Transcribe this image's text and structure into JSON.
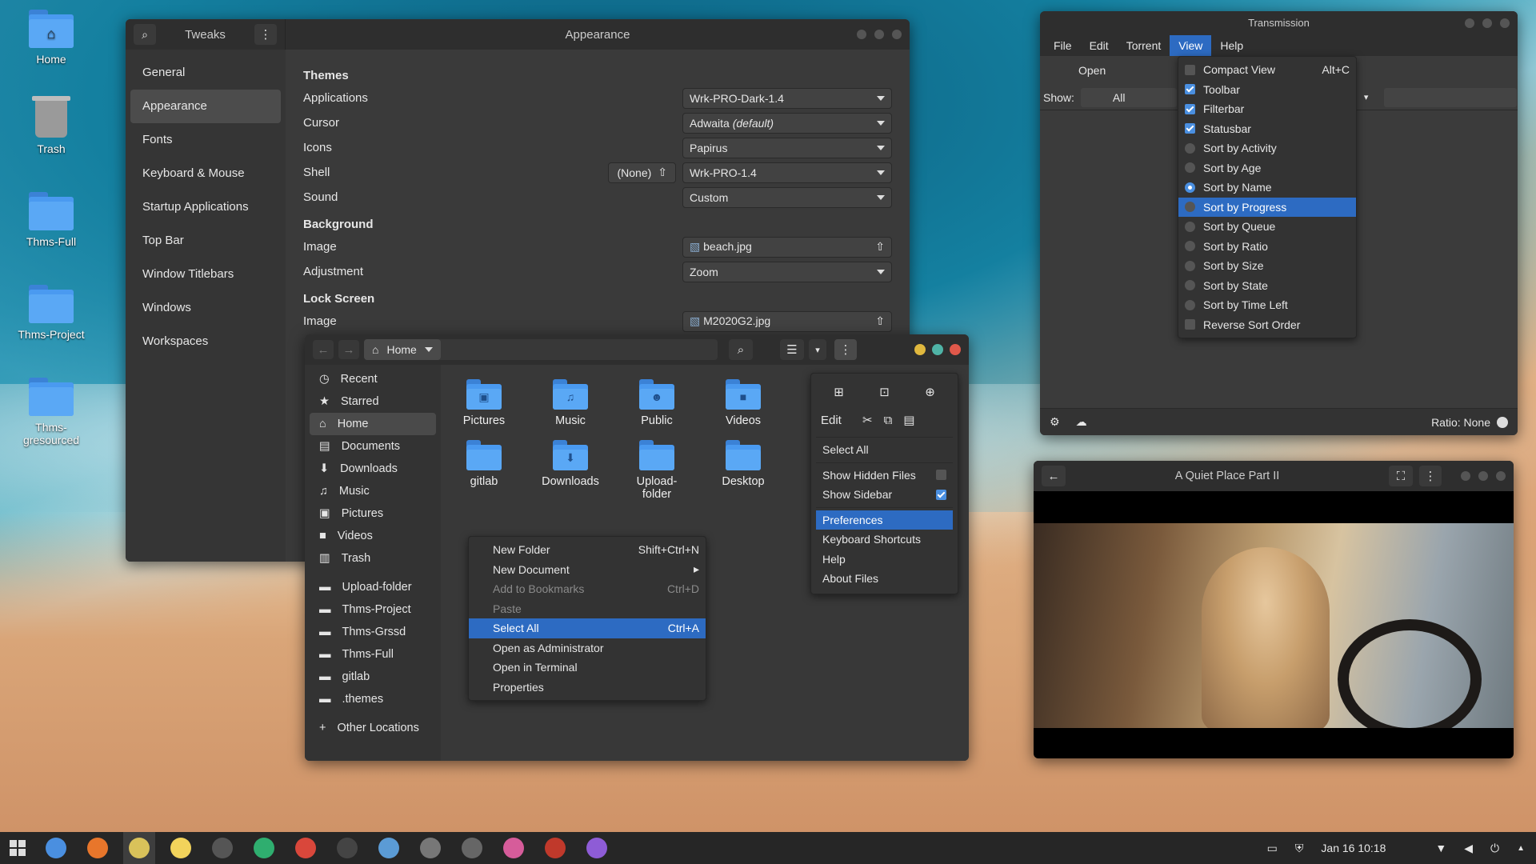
{
  "desktop": {
    "icons": [
      {
        "label": "Home",
        "icon": "home-folder-icon"
      },
      {
        "label": "Trash",
        "icon": "trash-icon"
      },
      {
        "label": "Thms-Full",
        "icon": "folder-icon"
      },
      {
        "label": "Thms-Project",
        "icon": "folder-icon"
      },
      {
        "label": "Thms-gresourced",
        "icon": "folder-icon"
      }
    ]
  },
  "tweaks": {
    "header_label": "Tweaks",
    "title": "Appearance",
    "sidebar": [
      "General",
      "Appearance",
      "Fonts",
      "Keyboard & Mouse",
      "Startup Applications",
      "Top Bar",
      "Window Titlebars",
      "Windows",
      "Workspaces"
    ],
    "themes": {
      "heading": "Themes",
      "applications_label": "Applications",
      "applications_value": "Wrk-PRO-Dark-1.4",
      "cursor_label": "Cursor",
      "cursor_value": "Adwaita",
      "cursor_default": "(default)",
      "icons_label": "Icons",
      "icons_value": "Papirus",
      "shell_label": "Shell",
      "shell_none": "(None)",
      "shell_value": "Wrk-PRO-1.4",
      "sound_label": "Sound",
      "sound_value": "Custom"
    },
    "background": {
      "heading": "Background",
      "image_label": "Image",
      "image_value": "beach.jpg",
      "adjustment_label": "Adjustment",
      "adjustment_value": "Zoom"
    },
    "lockscreen": {
      "heading": "Lock Screen",
      "image_label": "Image",
      "image_value": "M2020G2.jpg"
    }
  },
  "files": {
    "path": "Home",
    "sidebar": [
      "Recent",
      "Starred",
      "Home",
      "Documents",
      "Downloads",
      "Music",
      "Pictures",
      "Videos",
      "Trash"
    ],
    "bookmarks": [
      "Upload-folder",
      "Thms-Project",
      "Thms-Grssd",
      "Thms-Full",
      "gitlab",
      ".themes"
    ],
    "other_locations": "Other Locations",
    "grid": [
      {
        "label": "Pictures",
        "glyph": "▣"
      },
      {
        "label": "Music",
        "glyph": "♫"
      },
      {
        "label": "Public",
        "glyph": "☻"
      },
      {
        "label": "Videos",
        "glyph": "■"
      },
      {
        "label": "gitlab",
        "glyph": ""
      },
      {
        "label": "Downloads",
        "glyph": "⬇"
      },
      {
        "label": "Upload-\nfolder",
        "glyph": ""
      },
      {
        "label": "Desktop",
        "glyph": ""
      }
    ],
    "context_menu": [
      {
        "label": "New Folder",
        "shortcut": "Shift+Ctrl+N",
        "state": ""
      },
      {
        "label": "New Document",
        "shortcut": "▸",
        "state": ""
      },
      {
        "label": "Add to Bookmarks",
        "shortcut": "Ctrl+D",
        "state": "dis"
      },
      {
        "label": "Paste",
        "shortcut": "",
        "state": "dis"
      },
      {
        "label": "Select All",
        "shortcut": "Ctrl+A",
        "state": "hl"
      },
      {
        "label": "Open as Administrator",
        "shortcut": "",
        "state": ""
      },
      {
        "label": "Open in Terminal",
        "shortcut": "",
        "state": ""
      },
      {
        "label": "Properties",
        "shortcut": "",
        "state": ""
      }
    ],
    "app_menu": {
      "edit": "Edit",
      "select_all": "Select All",
      "show_hidden": "Show Hidden Files",
      "show_sidebar": "Show Sidebar",
      "preferences": "Preferences",
      "shortcuts": "Keyboard Shortcuts",
      "help": "Help",
      "about": "About Files"
    }
  },
  "transmission": {
    "title": "Transmission",
    "menubar": [
      "File",
      "Edit",
      "Torrent",
      "View",
      "Help"
    ],
    "open_label": "Open",
    "show_label": "Show:",
    "show_value": "All",
    "ratio": "Ratio: None",
    "view_menu": [
      {
        "label": "Compact View",
        "shortcut": "Alt+C",
        "mark": "chk",
        "on": false,
        "hl": false
      },
      {
        "label": "Toolbar",
        "shortcut": "",
        "mark": "chk",
        "on": true,
        "hl": false
      },
      {
        "label": "Filterbar",
        "shortcut": "",
        "mark": "chk",
        "on": true,
        "hl": false
      },
      {
        "label": "Statusbar",
        "shortcut": "",
        "mark": "chk",
        "on": true,
        "hl": false
      },
      {
        "label": "Sort by Activity",
        "shortcut": "",
        "mark": "rad",
        "on": false,
        "hl": false
      },
      {
        "label": "Sort by Age",
        "shortcut": "",
        "mark": "rad",
        "on": false,
        "hl": false
      },
      {
        "label": "Sort by Name",
        "shortcut": "",
        "mark": "rad",
        "on": true,
        "hl": false
      },
      {
        "label": "Sort by Progress",
        "shortcut": "",
        "mark": "rad",
        "on": false,
        "hl": true
      },
      {
        "label": "Sort by Queue",
        "shortcut": "",
        "mark": "rad",
        "on": false,
        "hl": false
      },
      {
        "label": "Sort by Ratio",
        "shortcut": "",
        "mark": "rad",
        "on": false,
        "hl": false
      },
      {
        "label": "Sort by Size",
        "shortcut": "",
        "mark": "rad",
        "on": false,
        "hl": false
      },
      {
        "label": "Sort by State",
        "shortcut": "",
        "mark": "rad",
        "on": false,
        "hl": false
      },
      {
        "label": "Sort by Time Left",
        "shortcut": "",
        "mark": "rad",
        "on": false,
        "hl": false
      },
      {
        "label": "Reverse Sort Order",
        "shortcut": "",
        "mark": "chk",
        "on": false,
        "hl": false
      }
    ]
  },
  "video": {
    "title": "A Quiet Place Part II"
  },
  "taskbar": {
    "clock": "Jan 16  10:18",
    "apps": [
      {
        "name": "chromium-icon",
        "color": "#4a8fe0"
      },
      {
        "name": "firefox-icon",
        "color": "#e8762b"
      },
      {
        "name": "files-icon",
        "color": "#d9c25a"
      },
      {
        "name": "text-editor-icon",
        "color": "#f2d35b"
      },
      {
        "name": "terminal-icon",
        "color": "#555555"
      },
      {
        "name": "transmission-icon",
        "color": "#2fae6f"
      },
      {
        "name": "gmail-icon",
        "color": "#d9473b"
      },
      {
        "name": "cat-icon",
        "color": "#444444"
      },
      {
        "name": "finder-icon",
        "color": "#5b9bd5"
      },
      {
        "name": "download-icon",
        "color": "#777777"
      },
      {
        "name": "share-icon",
        "color": "#666666"
      },
      {
        "name": "color-picker-icon",
        "color": "#d65c9a"
      },
      {
        "name": "archive-icon",
        "color": "#c0392b"
      },
      {
        "name": "play-store-icon",
        "color": "#8e5cd6"
      }
    ]
  }
}
